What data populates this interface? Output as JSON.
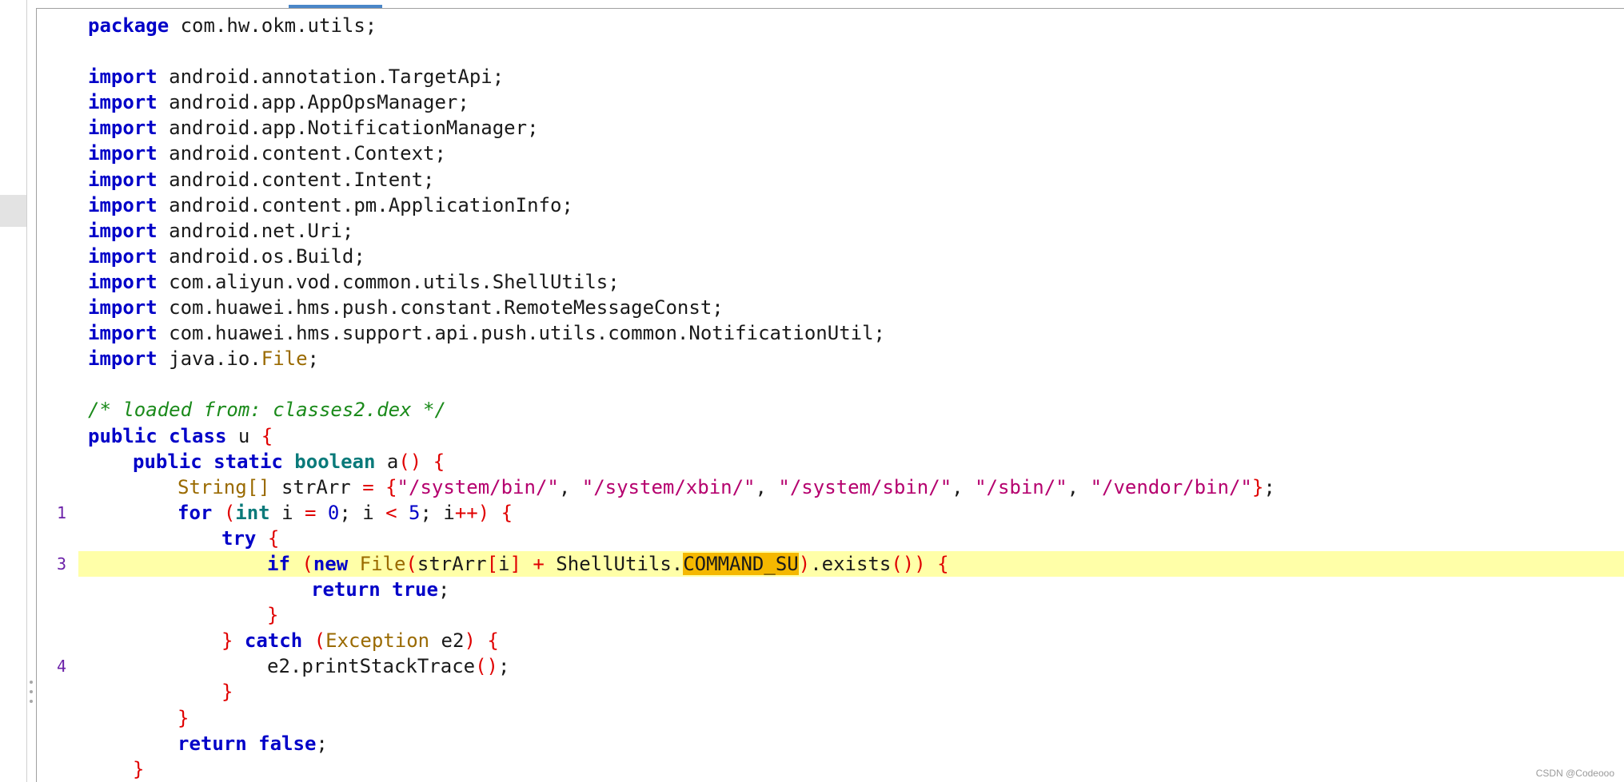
{
  "editor": {
    "gutter_numbers": {
      "l19": "1",
      "l22": "3",
      "l26": "4"
    },
    "lines": {
      "l0": [
        "package",
        " com.hw.okm.utils;"
      ],
      "l2": [
        "import",
        " android.annotation.TargetApi;"
      ],
      "l3": [
        "import",
        " android.app.AppOpsManager;"
      ],
      "l4": [
        "import",
        " android.app.NotificationManager;"
      ],
      "l5": [
        "import",
        " android.content.Context;"
      ],
      "l6": [
        "import",
        " android.content.Intent;"
      ],
      "l7": [
        "import",
        " android.content.pm.ApplicationInfo;"
      ],
      "l8": [
        "import",
        " android.net.Uri;"
      ],
      "l9": [
        "import",
        " android.os.Build;"
      ],
      "l10": [
        "import",
        " com.aliyun.vod.common.utils.ShellUtils;"
      ],
      "l11": [
        "import",
        " com.huawei.hms.push.constant.RemoteMessageConst;"
      ],
      "l12": [
        "import",
        " com.huawei.hms.support.api.push.utils.common.NotificationUtil;"
      ],
      "l13": [
        "import",
        " java.io.",
        "File",
        ";"
      ],
      "l15": "/* loaded from: classes2.dex */",
      "l16": [
        "public class",
        " u ",
        "{"
      ],
      "l17": [
        "public static",
        " ",
        "boolean",
        " a",
        "()",
        " ",
        "{"
      ],
      "l18": [
        "String[]",
        " strArr ",
        "=",
        " ",
        "{",
        "\"/system/bin/\"",
        ", ",
        "\"/system/xbin/\"",
        ", ",
        "\"/system/sbin/\"",
        ", ",
        "\"/sbin/\"",
        ", ",
        "\"/vendor/bin/\"",
        "}",
        ";"
      ],
      "l19": [
        "for",
        " ",
        "(",
        "int",
        " i ",
        "=",
        " ",
        "0",
        "; i ",
        "<",
        " ",
        "5",
        "; i",
        "++",
        ")",
        " ",
        "{"
      ],
      "l20": [
        "try",
        " ",
        "{"
      ],
      "l21": [
        "if",
        " ",
        "(",
        "new",
        " ",
        "File",
        "(",
        "strArr",
        "[",
        "i",
        "]",
        " ",
        "+",
        " ShellUtils.",
        "COMMAND_SU",
        ")",
        ".exists",
        "()",
        ")",
        " ",
        "{"
      ],
      "l22": [
        "return",
        " ",
        "true",
        ";"
      ],
      "l23": "}",
      "l24": [
        "}",
        " ",
        "catch",
        " ",
        "(",
        "Exception",
        " e2",
        ")",
        " ",
        "{"
      ],
      "l25": [
        "e2.printStackTrace",
        "()",
        ";"
      ],
      "l26": "}",
      "l27": "}",
      "l28": [
        "return",
        " ",
        "false",
        ";"
      ],
      "l29": "}"
    }
  },
  "watermark": "CSDN @Codeooo"
}
